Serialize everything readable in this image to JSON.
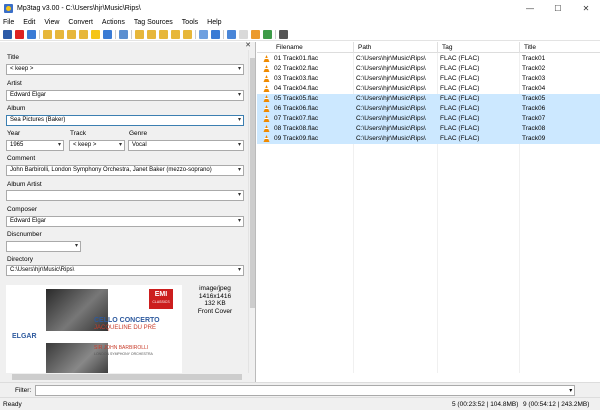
{
  "window": {
    "title": "Mp3tag v3.00  -  C:\\Users\\hjr\\Music\\Rips\\",
    "minimize": "—",
    "maximize": "☐",
    "close": "✕"
  },
  "menu": [
    "File",
    "Edit",
    "View",
    "Convert",
    "Actions",
    "Tag Sources",
    "Tools",
    "Help"
  ],
  "toolbar_icons": [
    "save-icon",
    "delete-icon",
    "undo-icon",
    "folder-open-icon",
    "refresh-icon",
    "filter-icon",
    "tag-file-icon",
    "star-icon",
    "tag-tag-icon",
    "export-icon",
    "settings-icon"
  ],
  "tag_panel": {
    "close": "✕",
    "fields": {
      "title": {
        "label": "Title",
        "value": "< keep >"
      },
      "artist": {
        "label": "Artist",
        "value": "Edward Elgar"
      },
      "album": {
        "label": "Album",
        "value": "Sea Pictures (Baker)"
      },
      "year": {
        "label": "Year",
        "value": "1965"
      },
      "track": {
        "label": "Track",
        "value": "< keep >"
      },
      "genre": {
        "label": "Genre",
        "value": "Vocal"
      },
      "comment": {
        "label": "Comment",
        "value": "John Barbirolli, London Symphony Orchestra, Janet Baker (mezzo-soprano)"
      },
      "album_artist": {
        "label": "Album Artist",
        "value": ""
      },
      "composer": {
        "label": "Composer",
        "value": "Edward Elgar"
      },
      "discnumber": {
        "label": "Discnumber",
        "value": ""
      },
      "directory": {
        "label": "Directory",
        "value": "C:\\Users\\hjr\\Music\\Rips\\"
      }
    },
    "cover": {
      "left_text": "ELGAR",
      "emi": "EMI",
      "emi_sub": "CLASSICS",
      "title": "CELLO CONCERTO",
      "soloist": "JACQUELINE DU PRÉ",
      "conductor": "SIR JOHN BARBIROLLI",
      "orchestra": "LONDON SYMPHONY ORCHESTRA"
    },
    "cover_info": {
      "mime": "image/jpeg",
      "dimensions": "1416x1416",
      "size": "132 KB",
      "type": "Front Cover"
    }
  },
  "file_list": {
    "columns": [
      "Filename",
      "Path",
      "Tag",
      "Title"
    ],
    "rows": [
      {
        "filename": "01 Track01.flac",
        "path": "C:\\Users\\hjr\\Music\\Rips\\",
        "tag": "FLAC (FLAC)",
        "title": "Track01",
        "selected": false
      },
      {
        "filename": "02 Track02.flac",
        "path": "C:\\Users\\hjr\\Music\\Rips\\",
        "tag": "FLAC (FLAC)",
        "title": "Track02",
        "selected": false
      },
      {
        "filename": "03 Track03.flac",
        "path": "C:\\Users\\hjr\\Music\\Rips\\",
        "tag": "FLAC (FLAC)",
        "title": "Track03",
        "selected": false
      },
      {
        "filename": "04 Track04.flac",
        "path": "C:\\Users\\hjr\\Music\\Rips\\",
        "tag": "FLAC (FLAC)",
        "title": "Track04",
        "selected": false
      },
      {
        "filename": "05 Track05.flac",
        "path": "C:\\Users\\hjr\\Music\\Rips\\",
        "tag": "FLAC (FLAC)",
        "title": "Track05",
        "selected": true
      },
      {
        "filename": "06 Track06.flac",
        "path": "C:\\Users\\hjr\\Music\\Rips\\",
        "tag": "FLAC (FLAC)",
        "title": "Track06",
        "selected": true
      },
      {
        "filename": "07 Track07.flac",
        "path": "C:\\Users\\hjr\\Music\\Rips\\",
        "tag": "FLAC (FLAC)",
        "title": "Track07",
        "selected": true
      },
      {
        "filename": "08 Track08.flac",
        "path": "C:\\Users\\hjr\\Music\\Rips\\",
        "tag": "FLAC (FLAC)",
        "title": "Track08",
        "selected": true
      },
      {
        "filename": "09 Track09.flac",
        "path": "C:\\Users\\hjr\\Music\\Rips\\",
        "tag": "FLAC (FLAC)",
        "title": "Track09",
        "selected": true
      }
    ]
  },
  "filter": {
    "label": "Filter:",
    "value": ""
  },
  "status": {
    "left": "Ready",
    "selection": "5 (00:23:52 | 104.8MB)",
    "total": "9 (00:54:12 | 243.2MB)"
  },
  "colors": {
    "selection": "#cce8ff",
    "panel": "#f0f0f0",
    "accent": "#3c7fb1"
  }
}
